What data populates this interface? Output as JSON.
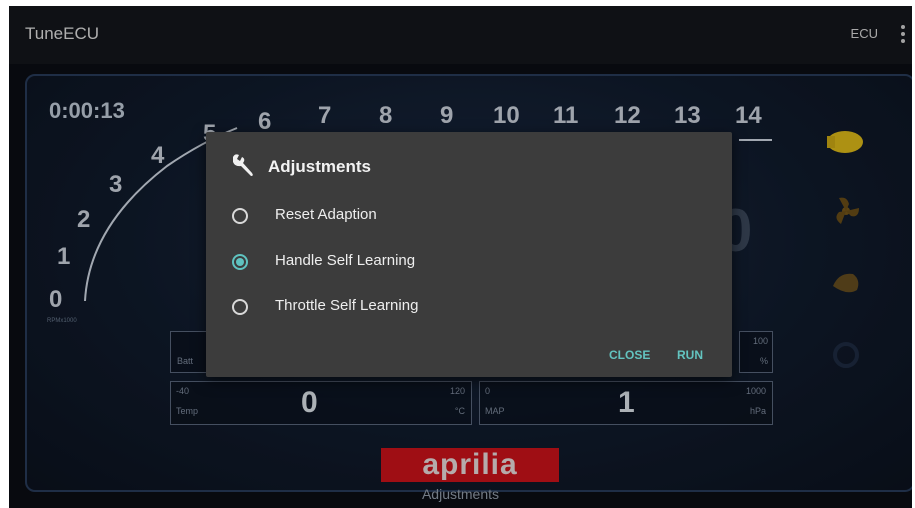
{
  "app": {
    "title": "TuneECU",
    "ecu_label": "ECU"
  },
  "dashboard": {
    "timer": "0:00:13",
    "rpm_scale": [
      "0",
      "1",
      "2",
      "3",
      "4",
      "5",
      "6",
      "7",
      "8",
      "9",
      "10",
      "11",
      "12",
      "13",
      "14"
    ],
    "rpm_unit": "RPMx1000",
    "big_digit": "0",
    "batt": {
      "label": "Batt",
      "max": "100",
      "unit": "%"
    },
    "temp": {
      "min": "-40",
      "label": "Temp",
      "value": "0",
      "max": "120",
      "unit": "°C"
    },
    "map": {
      "min": "0",
      "label": "MAP",
      "value": "1",
      "max": "1000",
      "unit": "hPa"
    },
    "brand": "aprilia",
    "caption": "Adjustments",
    "side_icons": [
      "engine-icon",
      "fan-icon",
      "throttle-icon",
      "power-icon"
    ]
  },
  "dialog": {
    "title": "Adjustments",
    "icon": "wrench-icon",
    "options": [
      {
        "label": "Reset Adaption",
        "checked": false
      },
      {
        "label": "Handle Self Learning",
        "checked": true
      },
      {
        "label": "Throttle Self Learning",
        "checked": false
      }
    ],
    "close_label": "CLOSE",
    "run_label": "RUN"
  },
  "colors": {
    "accent": "#5fc3c0",
    "brand_red": "#d4131b",
    "dialog_bg": "#3c3c3c"
  }
}
